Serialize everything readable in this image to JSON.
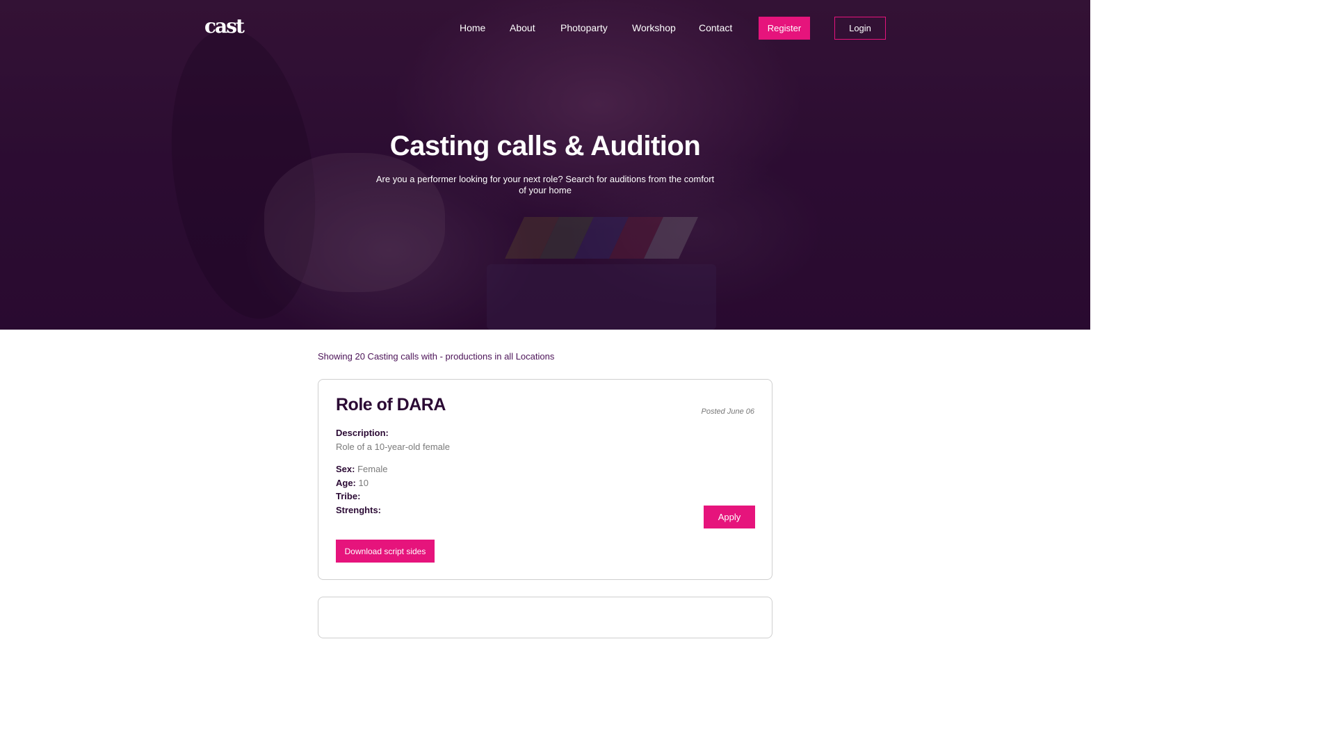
{
  "brand": {
    "logo_text": "cast"
  },
  "nav": {
    "items": [
      {
        "label": "Home"
      },
      {
        "label": "About"
      },
      {
        "label": "Photoparty"
      },
      {
        "label": "Workshop"
      },
      {
        "label": "Contact"
      }
    ],
    "register_label": "Register",
    "login_label": "Login"
  },
  "hero": {
    "title": "Casting calls & Audition",
    "subtitle": "Are you a performer looking for your next role? Search for auditions from the comfort of your home"
  },
  "results": {
    "summary": "Showing 20 Casting calls with - productions in all Locations"
  },
  "casting_calls": [
    {
      "title": "Role of DARA",
      "posted": "Posted June 06",
      "description_label": "Description:",
      "description": "Role of a 10-year-old female",
      "sex_label": "Sex:",
      "sex": "Female",
      "age_label": "Age:",
      "age": "10",
      "tribe_label": "Tribe:",
      "tribe": "",
      "strengths_label": "Strenghts:",
      "strengths": "",
      "apply_label": "Apply",
      "download_label": "Download script sides"
    }
  ],
  "colors": {
    "accent": "#e6147c",
    "heading": "#2b0a34",
    "hero_overlay": "#2e0f33"
  }
}
